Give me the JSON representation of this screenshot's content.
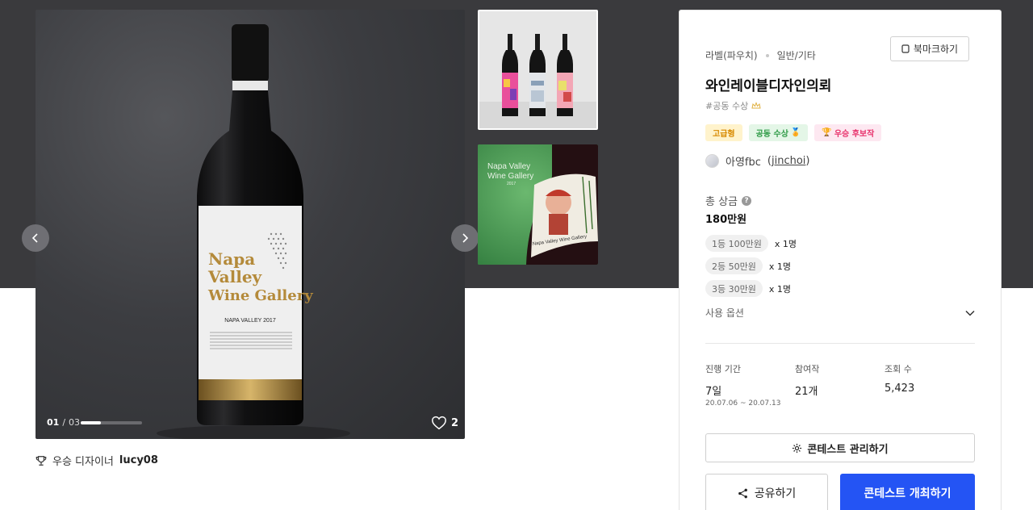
{
  "gallery": {
    "label": {
      "title_lines": [
        "Napa",
        "Valley",
        "Wine Gallery"
      ],
      "subtitle": "NAPA VALLEY 2017"
    },
    "counter_current": "01",
    "counter_total": "03",
    "progress_fraction": 0.33,
    "likes": "2",
    "thumb2_label_lines": [
      "Napa Valley",
      "Wine Gallery",
      "2017"
    ],
    "thumb2_bottle_text": "Napa Valley Wine Gallery"
  },
  "winner": {
    "label": "우승 디자이너",
    "name": "lucy08",
    "icon": "trophy-icon"
  },
  "panel": {
    "category": "라벨(파우치)",
    "subcategory": "일반/기타",
    "bookmark_label": "북마크하기",
    "title": "와인레이블디자인의뢰",
    "hashtag": "#공동 수상",
    "badges": [
      {
        "label": "고급형",
        "icon": ""
      },
      {
        "label": "공동 수상",
        "icon": "🏅"
      },
      {
        "label": "우승 후보작",
        "icon": "🏆"
      }
    ],
    "host_name": "아영fbc",
    "host_handle": "jinchoi",
    "prize_label": "총 상금",
    "prize_total": "180만원",
    "prizes": [
      {
        "rank": "1등 100만원",
        "count": "x 1명"
      },
      {
        "rank": "2등 50만원",
        "count": "x 1명"
      },
      {
        "rank": "3등 30만원",
        "count": "x 1명"
      }
    ],
    "options_label": "사용 옵션",
    "stats": {
      "duration_label": "진행 기간",
      "duration_value": "7일",
      "date_range": "20.07.06 ~ 20.07.13",
      "entries_label": "참여작",
      "entries_value": "21개",
      "views_label": "조회 수",
      "views_value": "5,423"
    },
    "manage_label": "콘테스트 관리하기",
    "share_label": "공유하기",
    "host_button_label": "콘테스트 개최하기"
  },
  "colors": {
    "band": "#3a3a3d",
    "primary": "#2454f4",
    "label_gold": "#b48a3a"
  }
}
